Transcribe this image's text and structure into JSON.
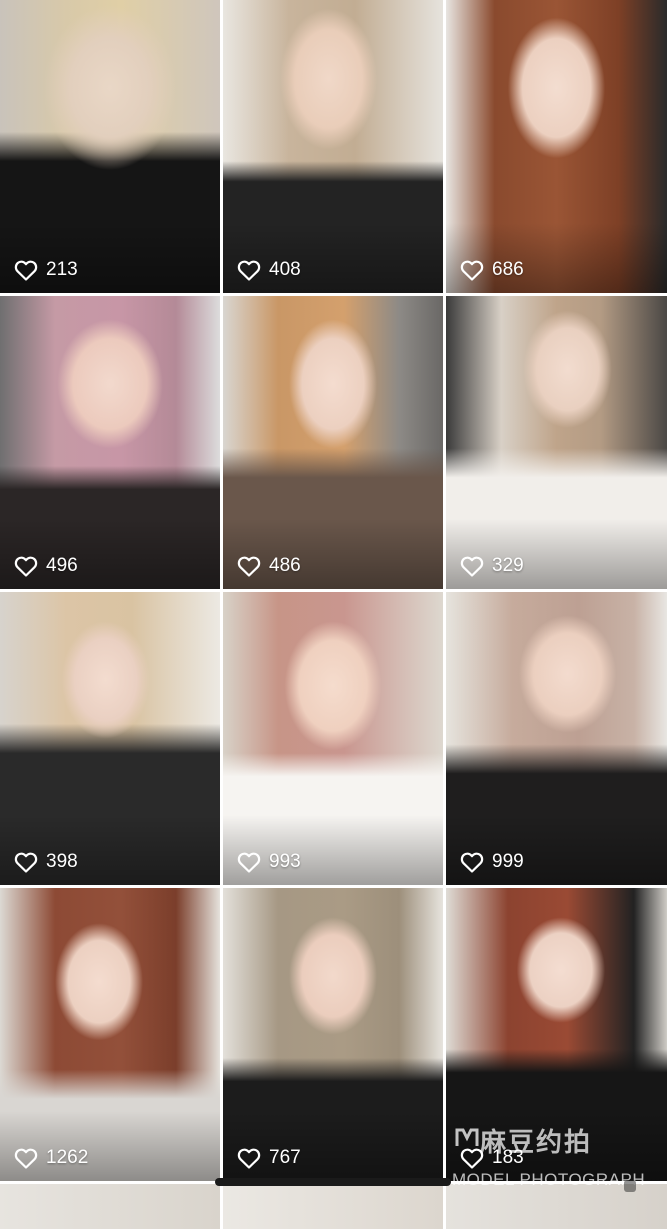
{
  "posts": [
    {
      "likes": "213"
    },
    {
      "likes": "408"
    },
    {
      "likes": "686"
    },
    {
      "likes": "496"
    },
    {
      "likes": "486"
    },
    {
      "likes": "329"
    },
    {
      "likes": "398"
    },
    {
      "likes": "993"
    },
    {
      "likes": "999"
    },
    {
      "likes": "1262"
    },
    {
      "likes": "767"
    },
    {
      "likes": "183"
    }
  ],
  "watermark": {
    "title": "麻豆约拍",
    "subtitle": "MODEL PHOTOGRAPH"
  },
  "icons": {
    "like": "heart-outline-icon"
  },
  "colors": {
    "like_text": "#ffffff"
  }
}
